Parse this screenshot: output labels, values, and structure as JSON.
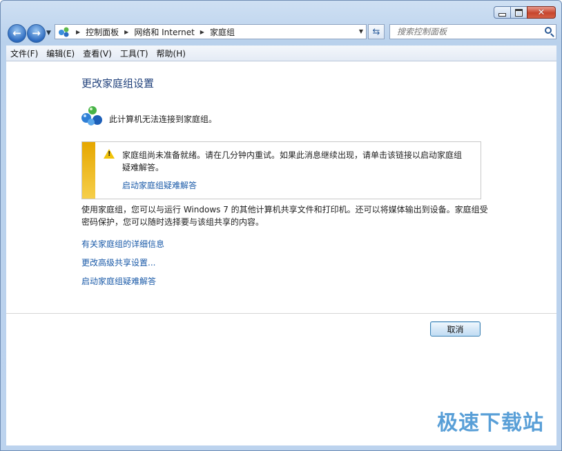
{
  "window": {
    "caption": {
      "minimize": "minimize",
      "maximize": "maximize",
      "close": "✕"
    }
  },
  "nav": {
    "breadcrumbs": [
      "控制面板",
      "网络和 Internet",
      "家庭组"
    ],
    "search_placeholder": "搜索控制面板"
  },
  "menu": [
    "文件(F)",
    "编辑(E)",
    "查看(V)",
    "工具(T)",
    "帮助(H)"
  ],
  "main": {
    "title": "更改家庭组设置",
    "status": "此计算机无法连接到家庭组。",
    "warning": {
      "text": "家庭组尚未准备就绪。请在几分钟内重试。如果此消息继续出现，请单击该链接以启动家庭组疑难解答。",
      "link": "启动家庭组疑难解答"
    },
    "description": "使用家庭组，您可以与运行 Windows 7 的其他计算机共享文件和打印机。还可以将媒体输出到设备。家庭组受密码保护，您可以随时选择要与该组共享的内容。",
    "links": [
      "有关家庭组的详细信息",
      "更改高级共享设置...",
      "启动家庭组疑难解答"
    ],
    "cancel_label": "取消"
  },
  "watermark": "极速下载站",
  "colors": {
    "link": "#1a5aa8",
    "title": "#1e3f7a",
    "warning_bar": "#e6a700"
  },
  "icons": [
    "back-arrow-icon",
    "forward-arrow-icon",
    "network-icon",
    "refresh-icon",
    "search-icon",
    "homegroup-icon",
    "warning-icon"
  ]
}
